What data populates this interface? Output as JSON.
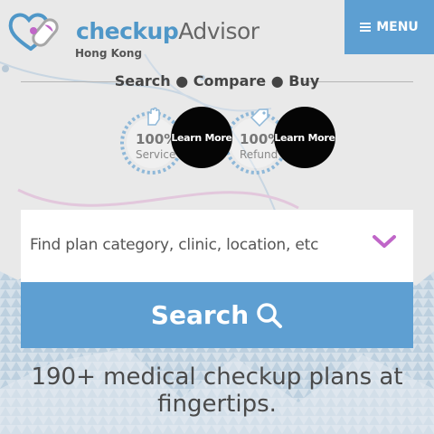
{
  "header": {
    "brand_part1": "checkup",
    "brand_part2": "Advisor",
    "region": "Hong Kong",
    "menu_label": "MENU",
    "logo_icon": "heart-pill-logo-icon",
    "menu_icon": "hamburger-icon"
  },
  "tagline": "Search ● Compare ● Buy",
  "badges": [
    {
      "percent": "100%",
      "label": "Service",
      "icon": "hand-icon",
      "learn_more": "Learn More"
    },
    {
      "percent": "100%",
      "label": "Refund",
      "icon": "price-tag-icon",
      "learn_more": "Learn More"
    }
  ],
  "search": {
    "placeholder": "Find plan category, clinic, location, etc",
    "dropdown_icon": "chevron-down-icon",
    "button_label": "Search",
    "button_icon": "search-icon"
  },
  "headline": "190+ medical checkup plans at fingertips.",
  "colors": {
    "brand_blue": "#4f97c8",
    "menu_bg": "#5d9fd2",
    "search_button_bg": "#5e9fd2",
    "chevron": "#c066c8",
    "learn_more_bg": "#050505"
  }
}
